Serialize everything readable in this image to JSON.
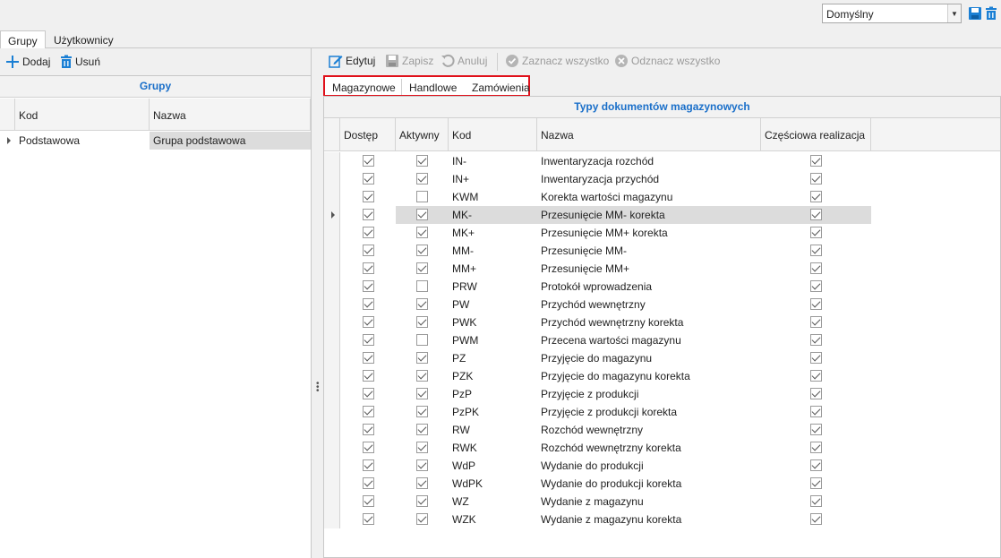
{
  "profile": {
    "value": "Domyślny"
  },
  "main_tabs": [
    {
      "label": "Grupy"
    },
    {
      "label": "Użytkownicy"
    }
  ],
  "left_toolbar": {
    "add": "Dodaj",
    "delete": "Usuń"
  },
  "groups_grid": {
    "title": "Grupy",
    "columns": [
      "Kod",
      "Nazwa"
    ],
    "rows": [
      {
        "kod": "Podstawowa",
        "nazwa": "Grupa podstawowa"
      }
    ]
  },
  "right_toolbar": {
    "edit": "Edytuj",
    "save": "Zapisz",
    "cancel": "Anuluj",
    "select_all": "Zaznacz wszystko",
    "deselect_all": "Odznacz wszystko"
  },
  "sub_tabs": [
    {
      "label": "Magazynowe"
    },
    {
      "label": "Handlowe"
    },
    {
      "label": "Zamówienia"
    }
  ],
  "doc_grid": {
    "title": "Typy dokumentów magazynowych",
    "columns": [
      "Dostęp",
      "Aktywny",
      "Kod",
      "Nazwa",
      "Częściowa realizacja"
    ],
    "selected_index": 3,
    "rows": [
      {
        "dostep": true,
        "aktywny": true,
        "kod": "IN-",
        "nazwa": "Inwentaryzacja rozchód",
        "czesciowa": true
      },
      {
        "dostep": true,
        "aktywny": true,
        "kod": "IN+",
        "nazwa": "Inwentaryzacja przychód",
        "czesciowa": true
      },
      {
        "dostep": true,
        "aktywny": false,
        "kod": "KWM",
        "nazwa": "Korekta wartości magazynu",
        "czesciowa": true
      },
      {
        "dostep": true,
        "aktywny": true,
        "kod": "MK-",
        "nazwa": "Przesunięcie MM- korekta",
        "czesciowa": true
      },
      {
        "dostep": true,
        "aktywny": true,
        "kod": "MK+",
        "nazwa": "Przesunięcie MM+ korekta",
        "czesciowa": true
      },
      {
        "dostep": true,
        "aktywny": true,
        "kod": "MM-",
        "nazwa": "Przesunięcie MM-",
        "czesciowa": true
      },
      {
        "dostep": true,
        "aktywny": true,
        "kod": "MM+",
        "nazwa": "Przesunięcie MM+",
        "czesciowa": true
      },
      {
        "dostep": true,
        "aktywny": false,
        "kod": "PRW",
        "nazwa": "Protokół wprowadzenia",
        "czesciowa": true
      },
      {
        "dostep": true,
        "aktywny": true,
        "kod": "PW",
        "nazwa": "Przychód wewnętrzny",
        "czesciowa": true
      },
      {
        "dostep": true,
        "aktywny": true,
        "kod": "PWK",
        "nazwa": "Przychód wewnętrzny korekta",
        "czesciowa": true
      },
      {
        "dostep": true,
        "aktywny": false,
        "kod": "PWM",
        "nazwa": "Przecena wartości magazynu",
        "czesciowa": true
      },
      {
        "dostep": true,
        "aktywny": true,
        "kod": "PZ",
        "nazwa": "Przyjęcie do magazynu",
        "czesciowa": true
      },
      {
        "dostep": true,
        "aktywny": true,
        "kod": "PZK",
        "nazwa": "Przyjęcie do magazynu korekta",
        "czesciowa": true
      },
      {
        "dostep": true,
        "aktywny": true,
        "kod": "PzP",
        "nazwa": "Przyjęcie z produkcji",
        "czesciowa": true
      },
      {
        "dostep": true,
        "aktywny": true,
        "kod": "PzPK",
        "nazwa": "Przyjęcie z produkcji korekta",
        "czesciowa": true
      },
      {
        "dostep": true,
        "aktywny": true,
        "kod": "RW",
        "nazwa": "Rozchód wewnętrzny",
        "czesciowa": true
      },
      {
        "dostep": true,
        "aktywny": true,
        "kod": "RWK",
        "nazwa": "Rozchód wewnętrzny korekta",
        "czesciowa": true
      },
      {
        "dostep": true,
        "aktywny": true,
        "kod": "WdP",
        "nazwa": "Wydanie do produkcji",
        "czesciowa": true
      },
      {
        "dostep": true,
        "aktywny": true,
        "kod": "WdPK",
        "nazwa": "Wydanie do produkcji korekta",
        "czesciowa": true
      },
      {
        "dostep": true,
        "aktywny": true,
        "kod": "WZ",
        "nazwa": "Wydanie z magazynu",
        "czesciowa": true
      },
      {
        "dostep": true,
        "aktywny": true,
        "kod": "WZK",
        "nazwa": "Wydanie z magazynu korekta",
        "czesciowa": true
      }
    ]
  }
}
